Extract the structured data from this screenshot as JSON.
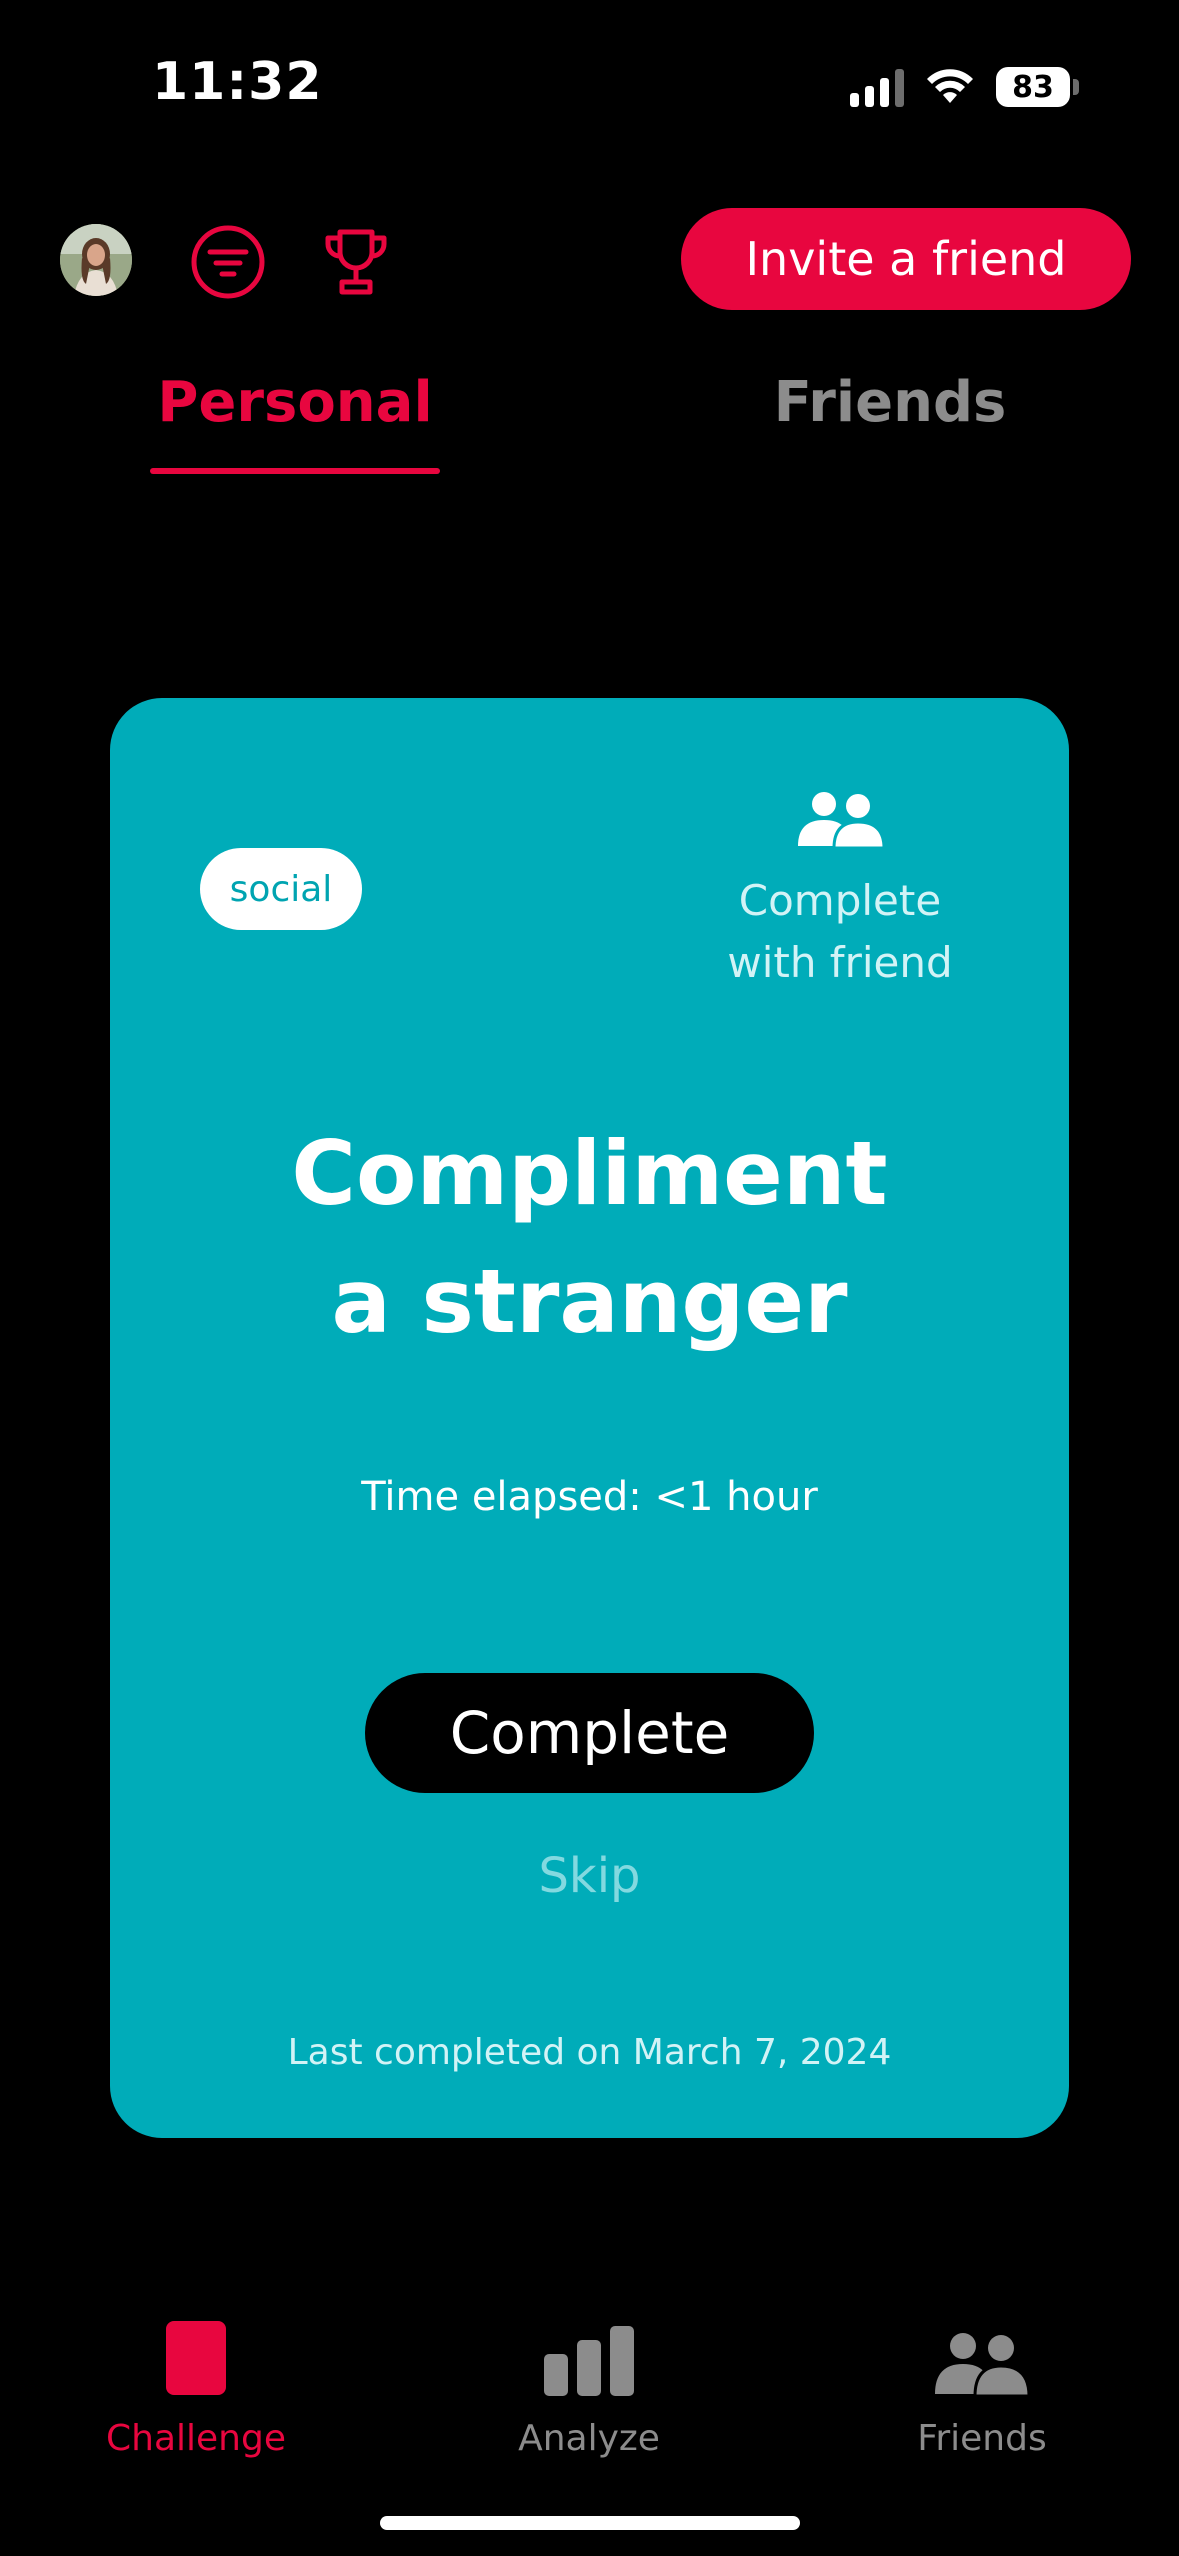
{
  "status_bar": {
    "time": "11:32",
    "battery_level": "83",
    "icons": [
      "cellular-signal-icon",
      "wifi-icon",
      "battery-icon"
    ]
  },
  "toolbar": {
    "avatar": "avatar",
    "filter_icon": "filter-icon",
    "trophy_icon": "trophy-icon",
    "invite_label": "Invite a friend"
  },
  "tabs": [
    {
      "label": "Personal",
      "active": true
    },
    {
      "label": "Friends",
      "active": false
    }
  ],
  "card": {
    "tag": "social",
    "complete_with_friend": "Complete\nwith friend",
    "title": "Compliment\na stranger",
    "time_elapsed": "Time elapsed: <1 hour",
    "complete_label": "Complete",
    "skip_label": "Skip",
    "last_completed": "Last completed on March 7, 2024"
  },
  "bottom_nav": [
    {
      "label": "Challenge",
      "icon": "challenge-icon",
      "active": true
    },
    {
      "label": "Analyze",
      "icon": "bar-chart-icon",
      "active": false
    },
    {
      "label": "Friends",
      "icon": "people-icon",
      "active": false
    }
  ],
  "colors": {
    "background": "#000000",
    "accent": "#e8063f",
    "card": "#00acb9",
    "inactive": "#8c8c8c"
  }
}
